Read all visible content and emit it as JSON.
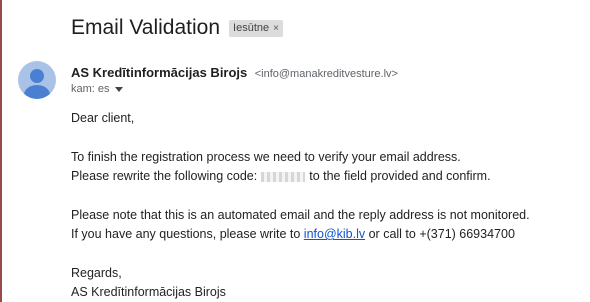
{
  "email": {
    "subject": "Email Validation",
    "label": "Iesūtne",
    "label_remove": "×",
    "sender_name": "AS Kredītinformācijas Birojs",
    "sender_email": "<info@manakreditvesture.lv>",
    "recipient": "kam: es",
    "body": {
      "greeting": "Dear client,",
      "line1": "To finish the registration process we need to verify your email address.",
      "line2_before": "Please rewrite the following code:",
      "line2_after": "to the field provided and confirm.",
      "line3": "Please note that this is an automated email and the reply address is not monitored.",
      "line4_before": "If you have any questions, please write to",
      "link": "info@kib.lv",
      "line4_after": "or call to +(371) 66934700",
      "closing": "Regards,",
      "signature": "AS Kredītinformācijas Birojs"
    }
  },
  "icons": {
    "avatar": "default-person-avatar-icon",
    "recipient_caret": "caret-down-icon",
    "label_remove": "close-icon"
  },
  "colors": {
    "link": "#1155cc",
    "avatar_bg": "#a9c2e8",
    "avatar_figure": "#4a7fd1",
    "label_chip_bg": "#dcdcdc"
  }
}
